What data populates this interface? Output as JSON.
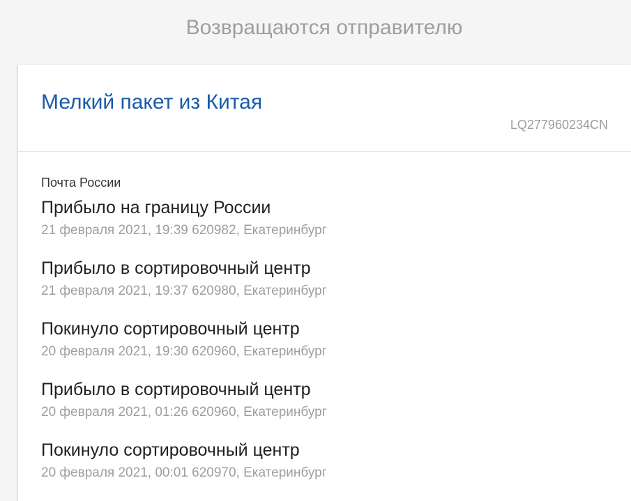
{
  "section": {
    "title": "Возвращаются отправителю"
  },
  "parcel": {
    "title": "Мелкий пакет из Китая",
    "tracking_number": "LQ277960234CN",
    "carrier": "Почта России",
    "events": [
      {
        "status": "Прибыло на границу России",
        "datetime": "21 февраля 2021, 19:39",
        "location": "620982, Екатеринбург"
      },
      {
        "status": "Прибыло в сортировочный центр",
        "datetime": "21 февраля 2021, 19:37",
        "location": "620980, Екатеринбург"
      },
      {
        "status": "Покинуло сортировочный центр",
        "datetime": "20 февраля 2021, 19:30",
        "location": "620960, Екатеринбург"
      },
      {
        "status": "Прибыло в сортировочный центр",
        "datetime": "20 февраля 2021, 01:26",
        "location": "620960, Екатеринбург"
      },
      {
        "status": "Покинуло сортировочный центр",
        "datetime": "20 февраля 2021, 00:01",
        "location": "620970, Екатеринбург"
      }
    ]
  },
  "colors": {
    "page_background": "#f5f5f5",
    "card_background": "#ffffff",
    "accent": "#1a5ca8",
    "heading_muted": "#9e9e9e",
    "text_primary": "#212121",
    "text_secondary": "#9e9e9e"
  }
}
